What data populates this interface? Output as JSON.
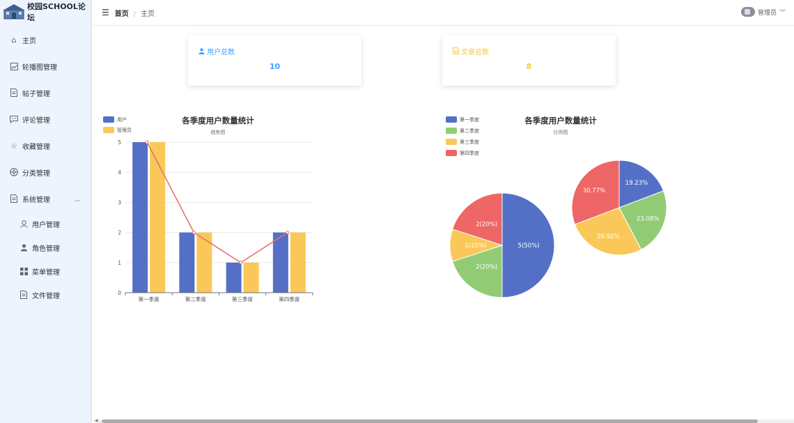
{
  "app": {
    "title": "校园SCHOOL论坛"
  },
  "sidebar": {
    "items": [
      {
        "label": "主页",
        "icon": "home-icon"
      },
      {
        "label": "轮播图管理",
        "icon": "picture-icon"
      },
      {
        "label": "帖子管理",
        "icon": "document-icon"
      },
      {
        "label": "评论管理",
        "icon": "comment-icon"
      },
      {
        "label": "收藏管理",
        "icon": "star-icon"
      },
      {
        "label": "分类管理",
        "icon": "category-icon"
      },
      {
        "label": "系统管理",
        "icon": "document-icon",
        "expanded": true
      }
    ],
    "subitems": [
      {
        "label": "用户管理",
        "icon": "user-icon"
      },
      {
        "label": "角色管理",
        "icon": "role-icon"
      },
      {
        "label": "菜单管理",
        "icon": "grid-menu-icon"
      },
      {
        "label": "文件管理",
        "icon": "file-icon"
      }
    ]
  },
  "header": {
    "breadcrumb": [
      "首页",
      "主页"
    ],
    "user": "管理员"
  },
  "stats": [
    {
      "label": "用户总数",
      "value": "10",
      "color": "#409eff",
      "icon": "user-icon"
    },
    {
      "label": "文章总数",
      "value": "8",
      "color": "#f6c93a",
      "icon": "article-icon"
    }
  ],
  "colors": {
    "blue": "#5470c6",
    "green": "#91cc75",
    "yellow": "#fac858",
    "red": "#ee6666",
    "line": "#e6736a"
  },
  "chart_data": [
    {
      "type": "bar",
      "title": "各季度用户数量统计",
      "subtitle": "趋势图",
      "categories": [
        "第一季度",
        "第二季度",
        "第三季度",
        "第四季度"
      ],
      "series": [
        {
          "name": "用户",
          "values": [
            5,
            2,
            1,
            2
          ]
        },
        {
          "name": "管理员",
          "values": [
            5,
            2,
            1,
            2
          ]
        }
      ],
      "line_overlay": [
        5,
        2,
        1,
        2
      ],
      "yticks": [
        0,
        1,
        2,
        3,
        4,
        5
      ],
      "ylim": [
        0,
        5
      ],
      "legend": "top-left"
    },
    {
      "type": "pie",
      "title": "各季度用户数量统计",
      "subtitle": "比例图",
      "legend_labels": [
        "第一季度",
        "第二季度",
        "第三季度",
        "第四季度"
      ],
      "pies": [
        {
          "values": [
            5,
            2,
            1,
            2
          ],
          "labels": [
            "5(50%)",
            "2(20%)",
            "1(10%)",
            "2(20%)"
          ]
        },
        {
          "values": [
            19.23,
            23.08,
            26.92,
            30.77
          ],
          "labels": [
            "19.23%",
            "23.08%",
            "26.92%",
            "30.77%"
          ]
        }
      ],
      "legend": "top-left"
    }
  ]
}
